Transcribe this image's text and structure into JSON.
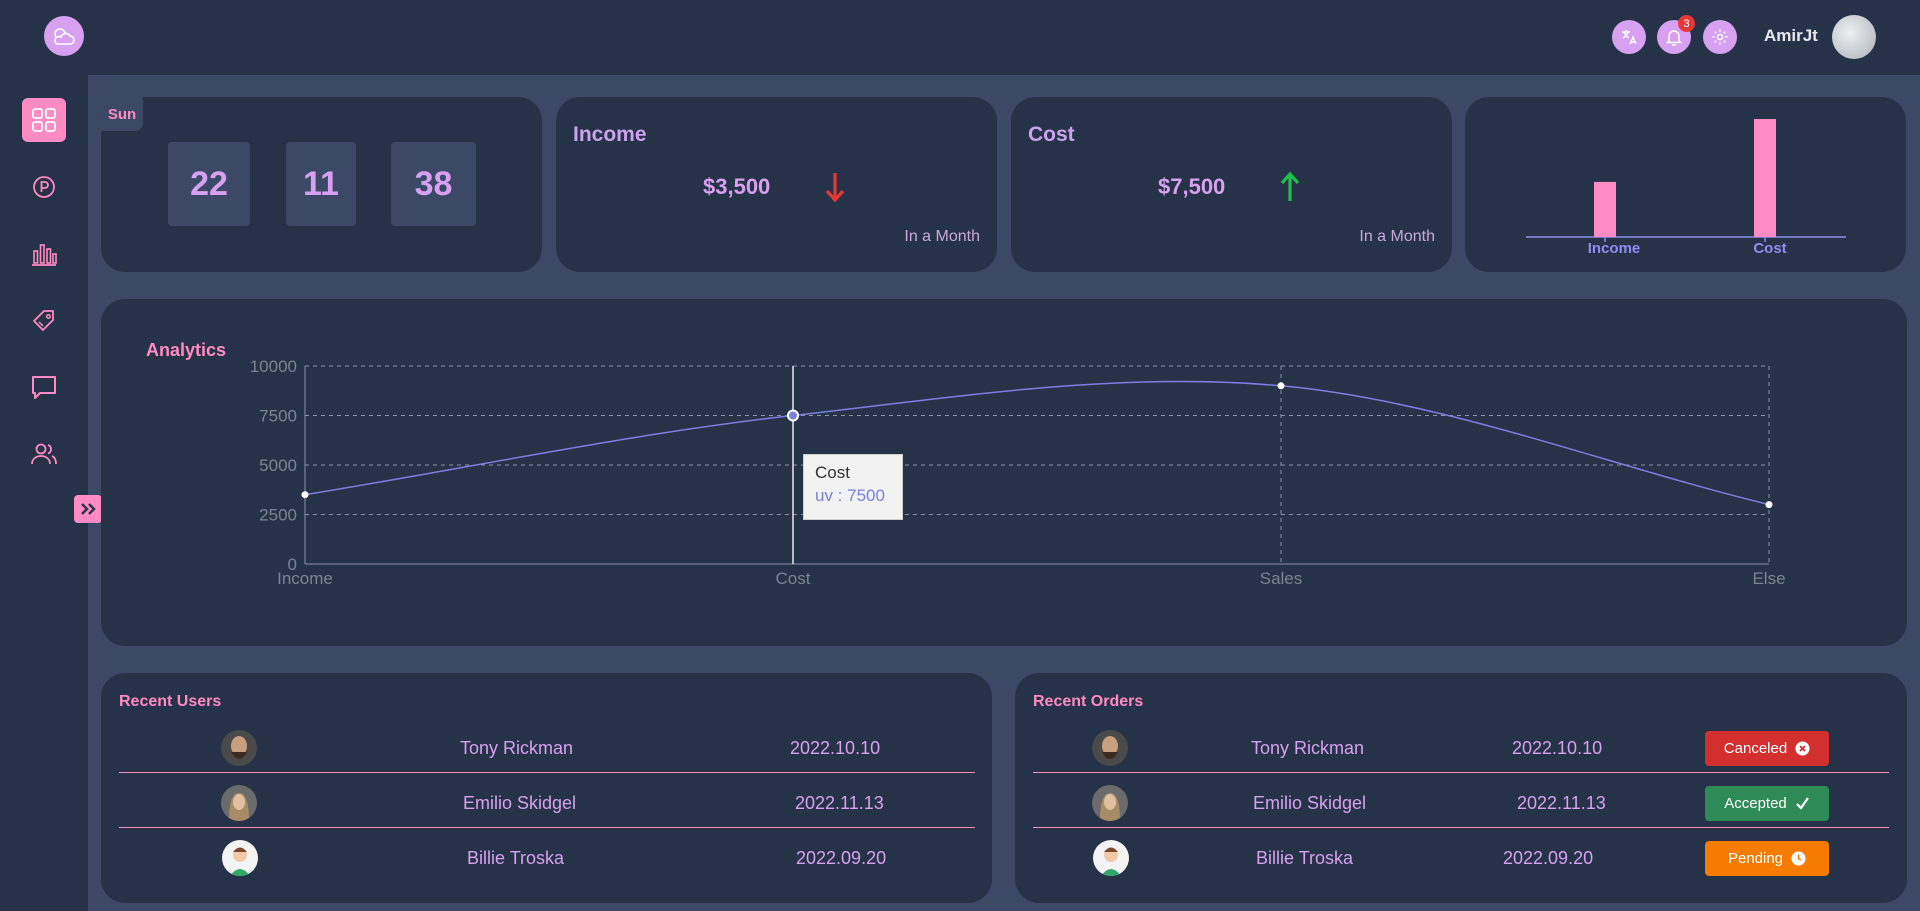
{
  "header": {
    "username": "AmirJt",
    "notification_count": "3",
    "icons": [
      "weather-logo-icon",
      "translate-icon",
      "bell-icon",
      "gear-icon"
    ]
  },
  "sidebar": {
    "items": [
      {
        "name": "dashboard",
        "icon": "grid-icon",
        "active": true
      },
      {
        "name": "parking",
        "icon": "parking-icon",
        "active": false
      },
      {
        "name": "stats",
        "icon": "bar-chart-icon",
        "active": false
      },
      {
        "name": "tags",
        "icon": "tag-icon",
        "active": false
      },
      {
        "name": "messages",
        "icon": "chat-icon",
        "active": false
      },
      {
        "name": "users",
        "icon": "users-icon",
        "active": false
      }
    ],
    "expand_icon": "chevrons-right-icon"
  },
  "clock": {
    "day": "Sun",
    "hours": "22",
    "minutes": "11",
    "seconds": "38"
  },
  "income": {
    "title": "Income",
    "value": "$3,500",
    "trend": "down",
    "sub": "In a Month"
  },
  "cost": {
    "title": "Cost",
    "value": "$7,500",
    "trend": "up",
    "sub": "In a Month"
  },
  "mini_chart": {
    "labels": [
      "Income",
      "Cost"
    ]
  },
  "analytics": {
    "title": "Analytics",
    "tooltip": {
      "label": "Cost",
      "value_text": "uv : 7500"
    }
  },
  "recent_users": {
    "title": "Recent Users",
    "rows": [
      {
        "name": "Tony Rickman",
        "date": "2022.10.10"
      },
      {
        "name": "Emilio Skidgel",
        "date": "2022.11.13"
      },
      {
        "name": "Billie Troska",
        "date": "2022.09.20"
      }
    ]
  },
  "recent_orders": {
    "title": "Recent Orders",
    "rows": [
      {
        "name": "Tony Rickman",
        "date": "2022.10.10",
        "status": "Canceled",
        "status_color": "#d32f2f",
        "status_icon": "x-circle-icon"
      },
      {
        "name": "Emilio Skidgel",
        "date": "2022.11.13",
        "status": "Accepted",
        "status_color": "#2e8b57",
        "status_icon": "check-icon"
      },
      {
        "name": "Billie Troska",
        "date": "2022.09.20",
        "status": "Pending",
        "status_color": "#f57c00",
        "status_icon": "clock-icon"
      }
    ]
  },
  "chart_data": [
    {
      "type": "bar",
      "categories": [
        "Income",
        "Cost"
      ],
      "values": [
        3500,
        7500
      ],
      "colors": [
        "#ff8ac4"
      ]
    },
    {
      "type": "line",
      "title": "Analytics",
      "categories": [
        "Income",
        "Cost",
        "Sales",
        "Else"
      ],
      "series": [
        {
          "name": "uv",
          "values": [
            3500,
            7500,
            9000,
            3000
          ],
          "color": "#7b7fe0"
        }
      ],
      "ylim": [
        0,
        10000
      ],
      "yticks": [
        0,
        2500,
        5000,
        7500,
        10000
      ],
      "grid": true,
      "active_index": 1
    }
  ],
  "colors": {
    "accent": "#ff8ac4",
    "lilac": "#d7a0f0",
    "card": "#263248",
    "bg": "#3b4966",
    "down": "#e53935",
    "up": "#1fbf4a"
  }
}
